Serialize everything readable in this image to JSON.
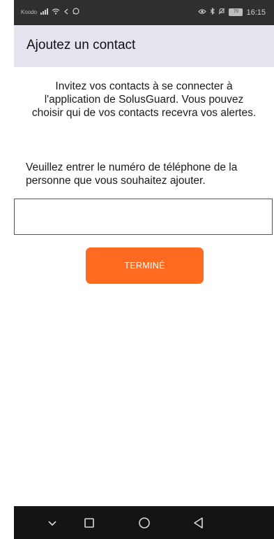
{
  "status_bar": {
    "carrier": "Koodo",
    "battery": "70",
    "time": "16:15",
    "left_icons": [
      "signal-icon",
      "wifi-icon",
      "cast-icon",
      "whatsapp-icon"
    ],
    "right_icons": [
      "eye-icon",
      "bluetooth-icon",
      "mute-icon",
      "battery-icon"
    ]
  },
  "header": {
    "title": "Ajoutez un contact",
    "background": "#e4e4ef"
  },
  "content": {
    "intro": "Invitez vos contacts à se connecter à l'application de SolusGuard. Vous pouvez choisir qui de vos contacts recevra vos alertes.",
    "instruction": "Veuillez entrer le numéro de téléphone de la personne que vous souhaitez ajouter.",
    "phone_input": {
      "value": "",
      "placeholder": ""
    },
    "done_button": {
      "label": "TERMINÉ",
      "color": "#ff6a21"
    }
  },
  "nav_bar": {
    "buttons": [
      "hide-keyboard-icon",
      "recents-icon",
      "home-icon",
      "back-icon"
    ]
  }
}
